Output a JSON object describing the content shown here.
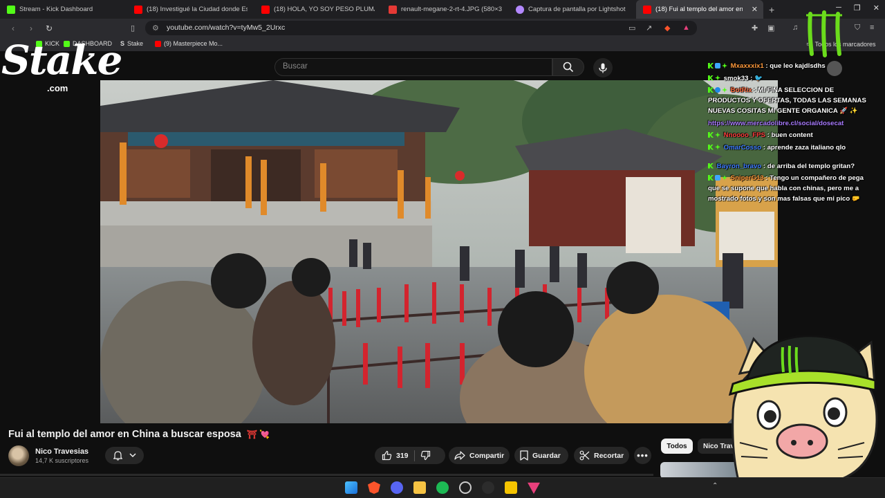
{
  "browser": {
    "tabs": [
      {
        "title": "Stream - Kick Dashboard",
        "icon": "kick-icon",
        "color": "#53fc18"
      },
      {
        "title": "(18) Investigué la Ciudad donde Escap",
        "icon": "youtube-icon",
        "color": "#ff0000"
      },
      {
        "title": "(18) HOLA, YO SOY PESO PLUMA // I",
        "icon": "youtube-icon",
        "color": "#ff0000"
      },
      {
        "title": "renault-megane-2-rt-4.JPG (580×319",
        "icon": "image-icon",
        "color": "#e53935"
      },
      {
        "title": "Captura de pantalla por Lightshot",
        "icon": "lightshot-icon",
        "color": "#b388ff"
      },
      {
        "title": "(18) Fui al templo del amor en",
        "icon": "youtube-icon",
        "color": "#ff0000",
        "active": true
      }
    ],
    "url": "youtube.com/watch?v=tyMw5_2Urxc",
    "bookmarks": [
      {
        "label": "KICK",
        "color": "#53fc18"
      },
      {
        "label": "DASHBOARD",
        "color": "#53fc18"
      },
      {
        "label": "Stake",
        "color": "#ffffff"
      },
      {
        "label": "(9) Masterpiece Mo...",
        "color": "#ff0000"
      }
    ],
    "bookmarks_all": "Todos los marcadores"
  },
  "youtube": {
    "search_placeholder": "Buscar",
    "video_title": "Fui al templo del amor en China a buscar esposa",
    "title_emoji": "⛩ 💘",
    "channel_name": "Nico Travesias",
    "subscribers": "14,7 K suscriptores",
    "likes": "319",
    "share_label": "Compartir",
    "save_label": "Guardar",
    "clip_label": "Recortar",
    "chip_all": "Todos",
    "chip_channel": "Nico Trav"
  },
  "overlay": {
    "stake_text": "Stake",
    "stake_sub": ".com"
  },
  "chat": [
    {
      "user": "Mxaxxxix1",
      "user_color": "#ff9a3c",
      "text": "que leo kajdlsdhs"
    },
    {
      "user": "smok33",
      "user_color": "#ffffff",
      "text": "🐦"
    },
    {
      "user": "BotRix",
      "user_color": "#ff6b3d",
      "text": "MI FINA SELECCION DE PRODUCTOS Y OFERTAS, TODAS LAS SEMANAS NUEVAS COSITAS MI GENTE ORGANICA 🚀 ✨"
    },
    {
      "user": "",
      "user_color": "#a97bff",
      "text": "https://www.mercadolibre.cl/social/dosecat",
      "is_link": true
    },
    {
      "user": "Nnoooo_FPS",
      "user_color": "#ff3b3b",
      "text": "buen content"
    },
    {
      "user": "OmarCosso",
      "user_color": "#3d7bff",
      "text": "aprende zaza italiano qlo"
    },
    {
      "user": "Bayron_bravo",
      "user_color": "#3d7bff",
      "text": "de arriba del templo gritan?"
    },
    {
      "user": "SniperG13",
      "user_color": "#ff9a3c",
      "text": "Tengo un compañero de pega que se supone que habla con chinas, pero me a mostrado fotos y son mas falsas que mi pico 🤛"
    }
  ],
  "colors": {
    "kick_green": "#53fc18",
    "youtube_red": "#ff0000",
    "bg": "#0f0f0f"
  }
}
